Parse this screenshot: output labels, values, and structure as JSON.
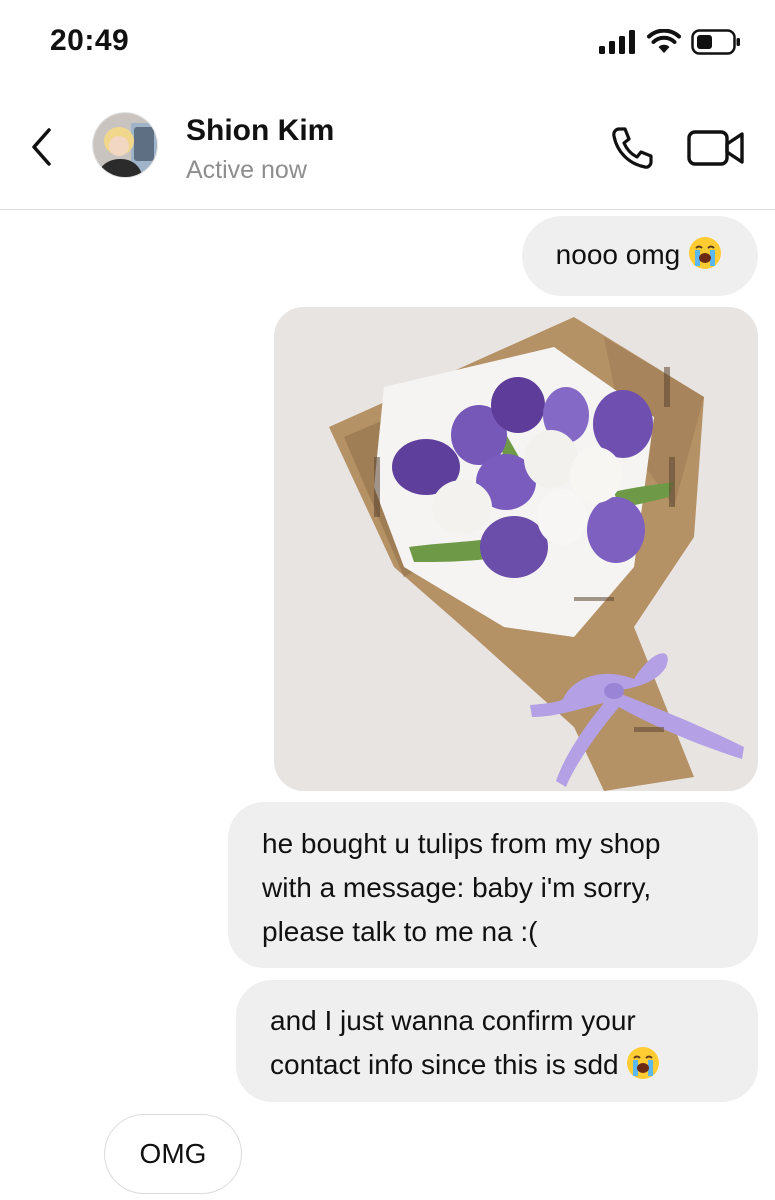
{
  "status_bar": {
    "time": "20:49",
    "icons": [
      "signal-icon",
      "wifi-icon",
      "battery-icon"
    ]
  },
  "header": {
    "contact_name": "Shion Kim",
    "contact_status": "Active now",
    "icons": [
      "back-chevron-icon",
      "phone-icon",
      "video-camera-icon"
    ]
  },
  "messages": [
    {
      "text": "nooo omg",
      "emoji": "loudly-crying-face"
    },
    {
      "type": "image",
      "description_icon": "tulip-bouquet-photo"
    },
    {
      "lines": [
        "he bought u tulips from my shop",
        "with a message: baby i'm sorry,",
        "please talk to me na :("
      ]
    },
    {
      "lines": [
        "and I just wanna confirm your",
        "contact info since this is sdd"
      ],
      "emoji": "loudly-crying-face"
    },
    {
      "text": "OMG"
    }
  ],
  "colors": {
    "bubble_gray": "#efefef",
    "secondary_text": "#8e8e8e",
    "tulip_purple": "#7b5cc0",
    "ribbon_lavender": "#b9a6e6",
    "kraft_paper": "#b89669"
  }
}
